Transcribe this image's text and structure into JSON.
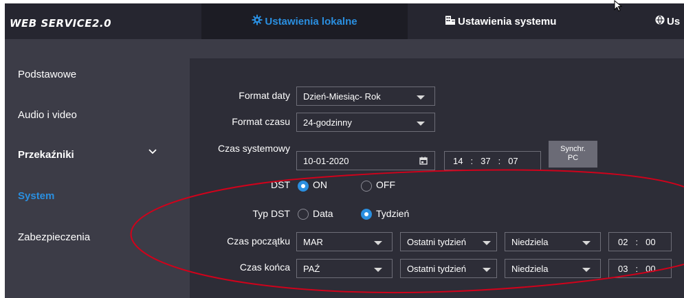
{
  "header": {
    "logo": "WEB SERVICE2.0",
    "tabs": [
      {
        "label": "Ustawienia lokalne",
        "icon": "gear-icon",
        "active": true
      },
      {
        "label": "Ustawienia systemu",
        "icon": "building-icon",
        "active": false
      },
      {
        "label": "Us",
        "icon": "globe-icon",
        "active": false
      }
    ]
  },
  "sidebar": {
    "items": [
      {
        "label": "Podstawowe"
      },
      {
        "label": "Audio i video"
      },
      {
        "label": "Przekaźniki",
        "expandable": true
      },
      {
        "label": "System",
        "active": true
      },
      {
        "label": "Zabezpieczenia"
      }
    ]
  },
  "form": {
    "date_format": {
      "label": "Format daty",
      "value": "Dzień-Miesiąc- Rok"
    },
    "time_format": {
      "label": "Format czasu",
      "value": "24-godzinny"
    },
    "system_time": {
      "label": "Czas systemowy",
      "date": "10-01-2020",
      "hh": "14",
      "mm": "37",
      "ss": "07",
      "sep": ":",
      "sync_label": "Synchr.\nPC",
      "sync_line1": "Synchr.",
      "sync_line2": "PC"
    },
    "dst": {
      "label": "DST",
      "on_label": "ON",
      "off_label": "OFF",
      "selected": "ON"
    },
    "dst_type": {
      "label": "Typ DST",
      "date_label": "Data",
      "week_label": "Tydzień",
      "selected": "Tydzień"
    },
    "start_time": {
      "label": "Czas początku",
      "month": "MAR",
      "week": "Ostatni tydzień",
      "day": "Niedziela",
      "hh": "02",
      "mm": "00",
      "sep": ":"
    },
    "end_time": {
      "label": "Czas końca",
      "month": "PAŹ",
      "week": "Ostatni tydzień",
      "day": "Niedziela",
      "hh": "03",
      "mm": "00",
      "sep": ":"
    }
  },
  "colors": {
    "accent": "#2a8fe0",
    "annotation": "#d0021b",
    "sidebar_bg": "#3c3c47",
    "topbar_bg": "#262630"
  }
}
